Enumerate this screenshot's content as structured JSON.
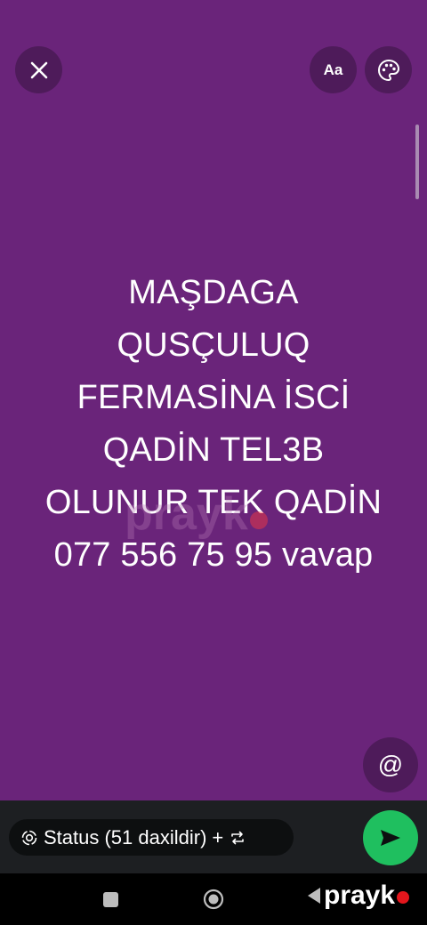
{
  "topbar": {
    "close_icon": "close-icon",
    "font_label": "Aa",
    "palette_icon": "palette-icon"
  },
  "status_text": "MAŞDAGA\nQUSÇULUQ\nFERMASİNA İSCİ\nQADİN TEL3B\nOLUNUR TEK QADİN\n077 556 75 95 vavap",
  "watermark": "prayk",
  "mention": {
    "icon": "at-sign-icon",
    "label": "@"
  },
  "bottom": {
    "status_label": "Status (51 daxildir)",
    "plus": "+",
    "swap_icon": "repeat-icon",
    "send_icon": "send-icon"
  },
  "navbar": {
    "brand": "prayk"
  },
  "colors": {
    "background": "#6a247a",
    "send": "#1fbf5f",
    "brand_dot": "#e3161c"
  }
}
